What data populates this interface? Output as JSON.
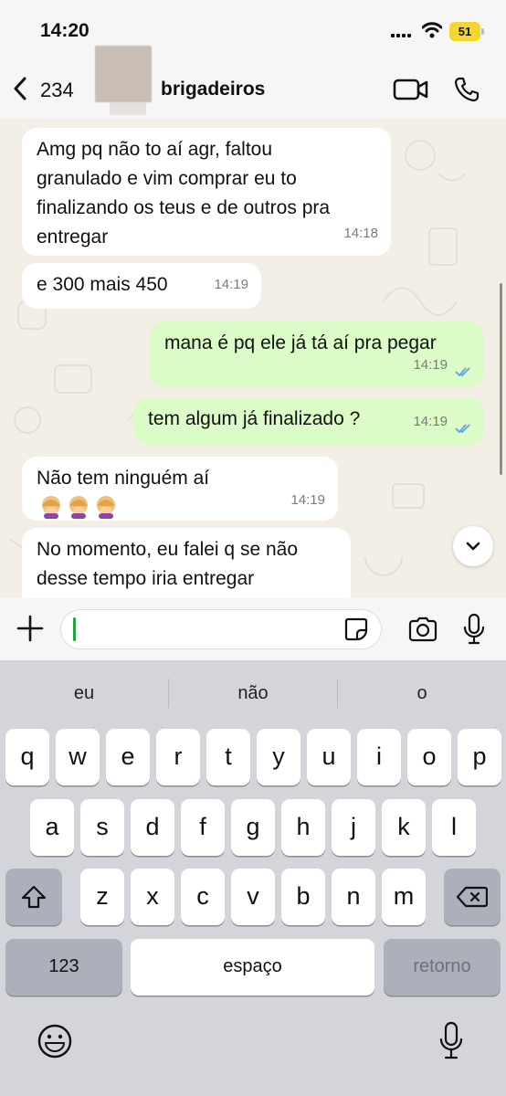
{
  "status": {
    "time": "14:20",
    "battery": "51"
  },
  "header": {
    "back_count": "234",
    "contact_name": "brigadeiros"
  },
  "messages": [
    {
      "direction": "in",
      "text": "Amg pq não to aí agr, faltou\ngranulado e vim comprar eu to\nfinalizando os teus e de outros pra\nentregar",
      "time": "14:18"
    },
    {
      "direction": "in",
      "text": "e 300 mais 450",
      "time": "14:19"
    },
    {
      "direction": "out",
      "text": "mana é pq ele já tá aí pra pegar",
      "time": "14:19",
      "status": "read"
    },
    {
      "direction": "out",
      "text": "tem algum já finalizado ?",
      "time": "14:19",
      "status": "read"
    },
    {
      "direction": "in",
      "text": "Não tem ninguém aí",
      "emojis": "woman-facepalming x3",
      "time": "14:19"
    },
    {
      "direction": "in",
      "text": "No momento, eu falei q se não\ndesse tempo iria entregar",
      "time": ""
    }
  ],
  "composer": {
    "value": "",
    "placeholder": ""
  },
  "keyboard": {
    "suggestions": [
      "eu",
      "não",
      "o"
    ],
    "row1": [
      "q",
      "w",
      "e",
      "r",
      "t",
      "y",
      "u",
      "i",
      "o",
      "p"
    ],
    "row2": [
      "a",
      "s",
      "d",
      "f",
      "g",
      "h",
      "j",
      "k",
      "l"
    ],
    "row3": [
      "z",
      "x",
      "c",
      "v",
      "b",
      "n",
      "m"
    ],
    "numbers_label": "123",
    "space_label": "espaço",
    "return_label": "retorno"
  },
  "colors": {
    "outgoing_bubble": "#dbfbc7",
    "incoming_bubble": "#ffffff",
    "read_ticks": "#4fa8ea",
    "cursor": "#25a244",
    "battery": "#f4d631"
  }
}
